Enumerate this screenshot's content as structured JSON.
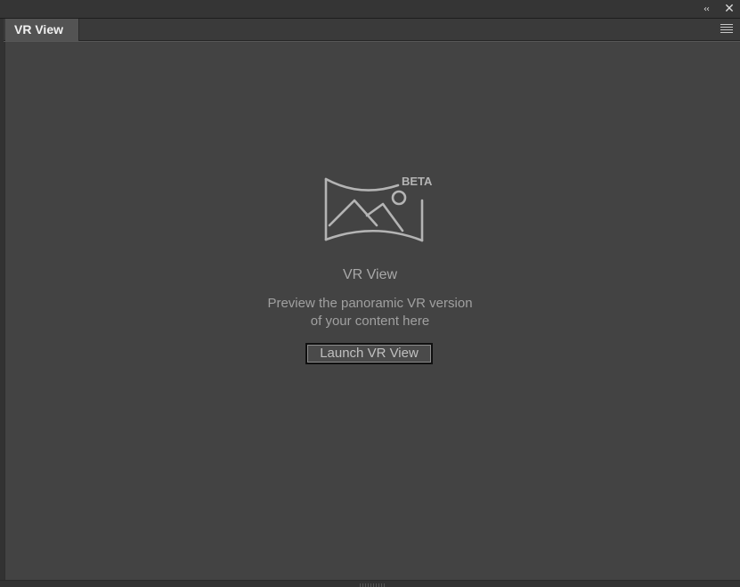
{
  "window": {
    "collapse_glyph": "‹‹",
    "close_glyph": "✕"
  },
  "tabs": [
    {
      "label": "VR View",
      "active": true
    }
  ],
  "empty_state": {
    "badge": "BETA",
    "title": "VR View",
    "description_line1": "Preview the panoramic VR version",
    "description_line2": "of your content here",
    "button_label": "Launch VR View"
  },
  "icons": {
    "collapse": "double-chevron-left-icon",
    "close": "close-icon",
    "panel_menu": "hamburger-menu-icon",
    "illustration": "panorama-image-icon"
  },
  "colors": {
    "panel_background": "#434343",
    "chrome_background": "#323232",
    "tab_active": "#535353",
    "text_primary": "#a8a8a8",
    "illustration_stroke": "#b4b4b4"
  }
}
